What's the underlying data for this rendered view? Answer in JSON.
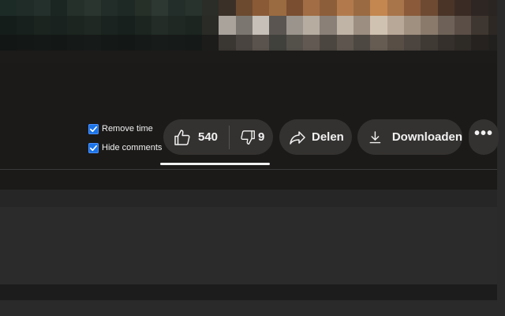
{
  "filters": [
    {
      "label": "Remove time",
      "checked": true
    },
    {
      "label": "Hide comments",
      "checked": true
    }
  ],
  "actions": {
    "like_count": "540",
    "dislike_count": "9",
    "share_label": "Delen",
    "download_label": "Downloaden",
    "more_label": "•••"
  },
  "colors": {
    "background": "#1b1a19",
    "pill": "#343230",
    "checkbox": "#1a73e8",
    "text": "#f1f1f1"
  },
  "icons": [
    "thumbs-up-icon",
    "thumbs-down-icon",
    "share-arrow-icon",
    "download-icon",
    "more-dots-icon",
    "checkmark-icon"
  ]
}
